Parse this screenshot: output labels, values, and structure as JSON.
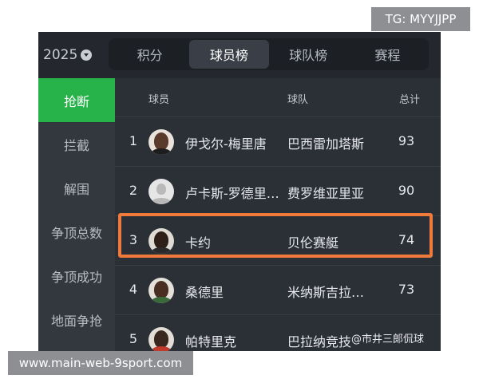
{
  "header": {
    "year": "2025",
    "tabs": [
      {
        "label": "积分",
        "active": false
      },
      {
        "label": "球员榜",
        "active": true
      },
      {
        "label": "球队榜",
        "active": false
      },
      {
        "label": "赛程",
        "active": false
      }
    ]
  },
  "sidebar": {
    "items": [
      {
        "label": "抢断",
        "active": true
      },
      {
        "label": "拦截",
        "active": false
      },
      {
        "label": "解围",
        "active": false
      },
      {
        "label": "争顶总数",
        "active": false
      },
      {
        "label": "争顶成功",
        "active": false
      },
      {
        "label": "地面争抢",
        "active": false
      }
    ]
  },
  "table": {
    "columns": {
      "player": "球员",
      "team": "球队",
      "total": "总计"
    },
    "rows": [
      {
        "rank": "1",
        "player": "伊戈尔-梅里唐",
        "team": "巴西雷加塔斯",
        "total": "93",
        "avatar": "photo"
      },
      {
        "rank": "2",
        "player": "卢卡斯-罗德里…",
        "team": "费罗维亚里亚",
        "total": "90",
        "avatar": "default"
      },
      {
        "rank": "3",
        "player": "卡约",
        "team": "贝伦赛艇",
        "total": "74",
        "avatar": "photo",
        "highlighted": true
      },
      {
        "rank": "4",
        "player": "桑德里",
        "team": "米纳斯吉拉…",
        "total": "73",
        "avatar": "photo"
      },
      {
        "rank": "5",
        "player": "帕特里克",
        "team": "巴拉纳竞技",
        "total": "",
        "avatar": "photo"
      }
    ]
  },
  "overlays": {
    "tg_label": "TG: MYYJJPP",
    "site_label": "www.main-web-9sport.com",
    "watermark": "@市井三郞侃球"
  },
  "colors": {
    "accent_green": "#27b24a",
    "highlight_orange": "#f07a3a",
    "background": "#2b2f36"
  }
}
